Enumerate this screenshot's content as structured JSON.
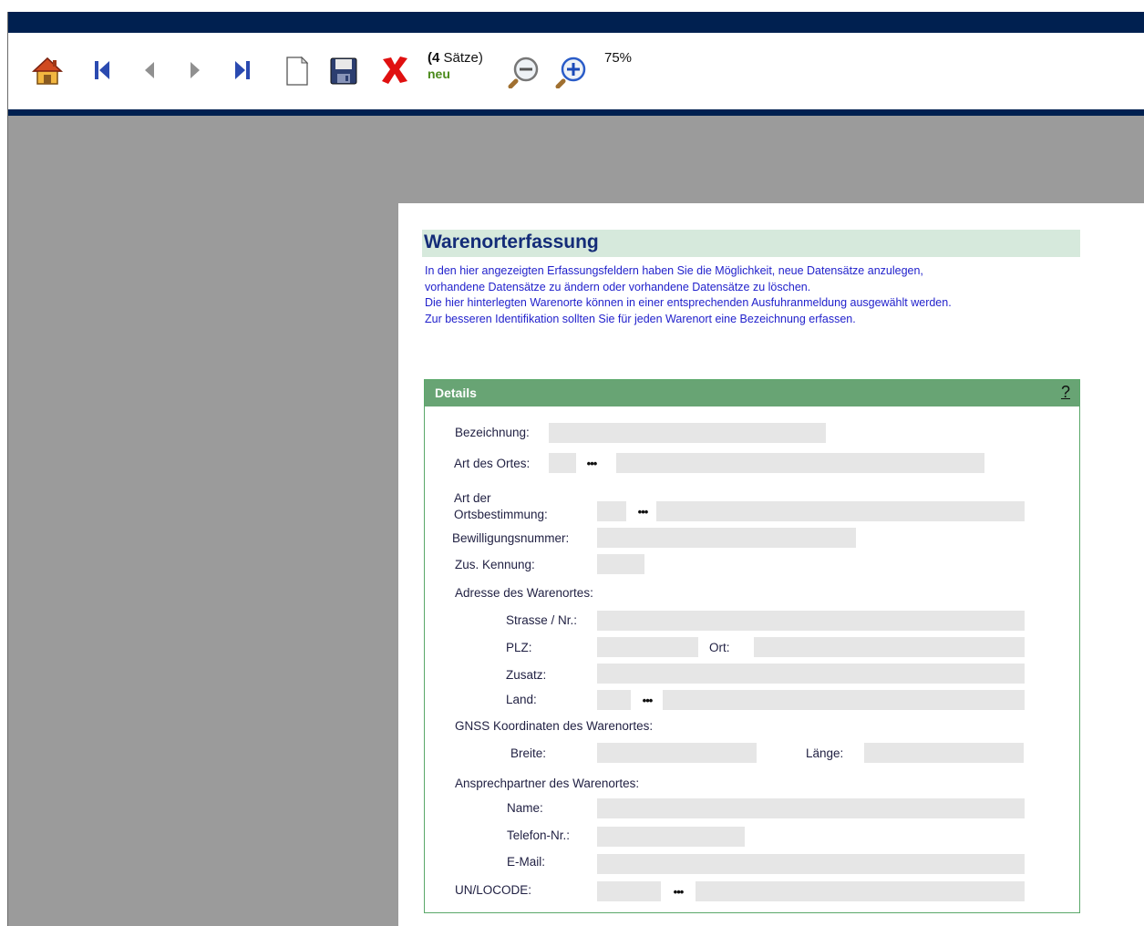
{
  "toolbar": {
    "record_count_number": "(4",
    "record_count_unit": " Sätze)",
    "status": "neu",
    "zoom_level": "75%",
    "icons": [
      "home-icon",
      "first-record-icon",
      "previous-record-icon",
      "next-record-icon",
      "last-record-icon",
      "new-document-icon",
      "save-icon",
      "delete-icon",
      "zoom-out-icon",
      "zoom-in-icon"
    ]
  },
  "form": {
    "title": "Warenorterfassung",
    "intro": [
      "In den hier angezeigten Erfassungsfeldern haben Sie die Möglichkeit, neue Datensätze anzulegen,",
      "vorhandene Datensätze zu ändern oder vorhandene Datensätze zu löschen.",
      "Die hier hinterlegten Warenorte können in einer entsprechenden Ausfuhranmeldung ausgewählt werden.",
      "Zur besseren Identifikation sollten Sie für jeden Warenort eine Bezeichnung erfassen."
    ],
    "details_title": "Details",
    "help_label": "?",
    "lookup_label": "•••",
    "labels": {
      "bezeichnung": "Bezeichnung:",
      "art_des_ortes": "Art des Ortes:",
      "art_der": "Art der",
      "ortsbestimmung": "Ortsbestimmung:",
      "bewilligungsnummer": "Bewilligungsnummer:",
      "zus_kennung": "Zus. Kennung:",
      "adresse_header": "Adresse des Warenortes:",
      "strasse": "Strasse / Nr.:",
      "plz": "PLZ:",
      "ort": "Ort:",
      "zusatz": "Zusatz:",
      "land": "Land:",
      "gnss_header": "GNSS Koordinaten des Warenortes:",
      "breite": "Breite:",
      "laenge": "Länge:",
      "ansprech_header": "Ansprechpartner des Warenortes:",
      "name": "Name:",
      "telefon": "Telefon-Nr.:",
      "email": "E-Mail:",
      "unlocode": "UN/LOCODE:"
    },
    "values": {
      "bezeichnung": "",
      "art_des_ortes_code": "",
      "art_des_ortes_text": "",
      "ortsbestimmung_code": "",
      "ortsbestimmung_text": "",
      "bewilligungsnummer": "",
      "zus_kennung": "",
      "strasse": "",
      "plz": "",
      "ort": "",
      "zusatz": "",
      "land_code": "",
      "land_text": "",
      "breite": "",
      "laenge": "",
      "name": "",
      "telefon": "",
      "email": "",
      "unlocode_code": "",
      "unlocode_text": ""
    }
  },
  "colors": {
    "top_bar": "#002050",
    "background": "#9b9b9b",
    "title_band": "#d6e9dc",
    "panel_header": "#68a474",
    "intro_text": "#2222cc",
    "field_bg": "#e6e6e6"
  }
}
